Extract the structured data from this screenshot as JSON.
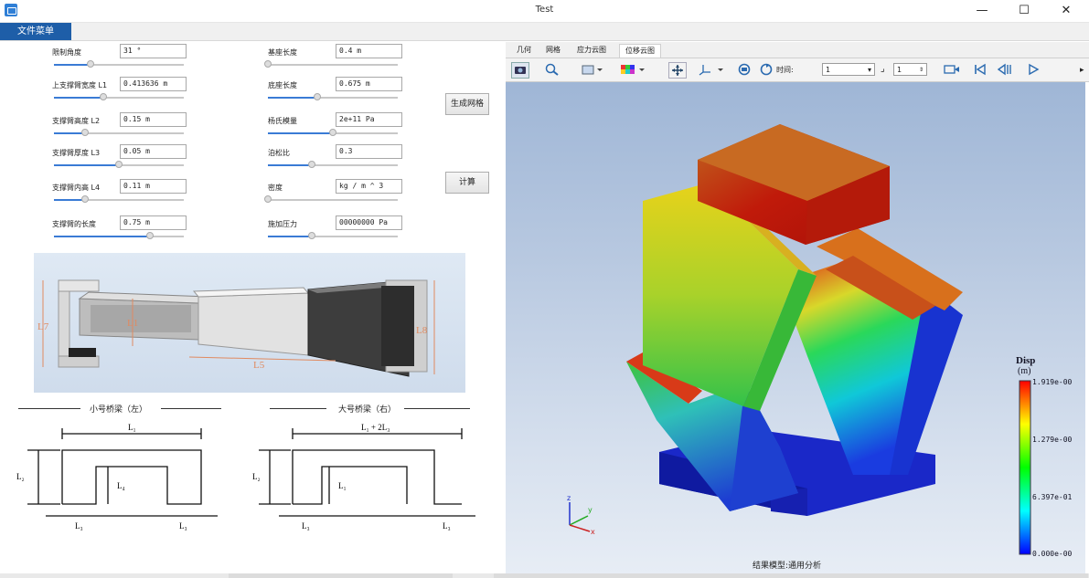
{
  "window": {
    "title": "Test",
    "minimize": "—",
    "maximize": "☐",
    "close": "✕"
  },
  "menu": {
    "file": "文件菜单"
  },
  "params": {
    "left": [
      {
        "label": "限制角度",
        "value": "31 °",
        "fill": 0.28
      },
      {
        "label": "上支撑臂宽度 L1",
        "value": "0.413636 m",
        "fill": 0.38
      },
      {
        "label": "支撑臂高度 L2",
        "value": "0.15 m",
        "fill": 0.24
      },
      {
        "label": "支撑臂厚度 L3",
        "value": "0.05 m",
        "fill": 0.5
      },
      {
        "label": "支撑臂内高 L4",
        "value": "0.11 m",
        "fill": 0.24
      },
      {
        "label": "支撑臂的长度",
        "value": "0.75 m",
        "fill": 0.74
      }
    ],
    "right": [
      {
        "label": "基座长度",
        "value": "0.4 m",
        "fill": 0.0
      },
      {
        "label": "底座长度",
        "value": "0.675 m",
        "fill": 0.38
      },
      {
        "label": "杨氏模量",
        "value": "2e+11 Pa",
        "fill": 0.5
      },
      {
        "label": "泊松比",
        "value": "0.3",
        "fill": 0.34
      },
      {
        "label": "密度",
        "value": " kg / m ^ 3",
        "fill": 0.0
      },
      {
        "label": "施加压力",
        "value": "00000000 Pa",
        "fill": 0.34
      }
    ]
  },
  "buttons": {
    "mesh": "生成网格",
    "compute": "计算"
  },
  "diagram": {
    "labels": {
      "l7": "L7",
      "l1": "L1",
      "l5": "L5",
      "l8": "L8"
    },
    "small_title": "小号桥梁（左）",
    "large_title": "大号桥梁（右）",
    "small": {
      "top": "L₁",
      "left": "L₂",
      "inner": "L₄",
      "bl": "L₃",
      "br": "L₃"
    },
    "large": {
      "top": "L₁ + 2L₃",
      "left": "L₂",
      "inner": "L₁",
      "bl": "L₃",
      "br": "L₃"
    }
  },
  "viewer": {
    "tabs": [
      "几何",
      "网格",
      "应力云图",
      "位移云图"
    ],
    "active_tab": 3,
    "time_label": "时间:",
    "time_value": "1",
    "step_value": "1",
    "result_caption": "结果模型:通用分析",
    "legend": {
      "title": "Disp",
      "unit": "(m)",
      "max": "1.919e-00",
      "mid": "1.279e-00",
      "low": "6.397e-01",
      "min": "0.000e-00"
    }
  },
  "colors": {
    "accent": "#1e5ea8",
    "slider": "#3a7bd5"
  }
}
